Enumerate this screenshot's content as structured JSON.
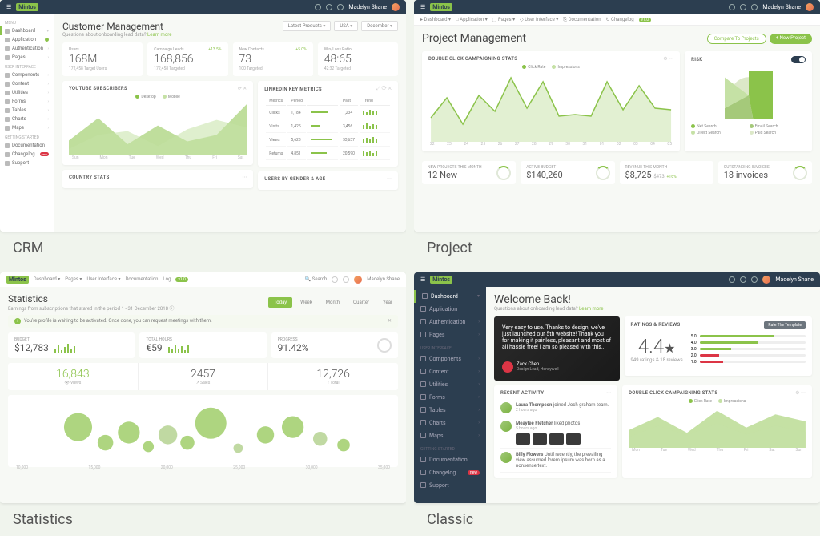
{
  "brand": "Mintos",
  "user": "Madelyn Shane",
  "labels": {
    "crm": "CRM",
    "project": "Project",
    "statistics": "Statistics",
    "classic": "Classic"
  },
  "sidebar_light": {
    "menu_hdr": "MENU",
    "items": [
      {
        "label": "Dashboard",
        "active": true
      },
      {
        "label": "Application",
        "dot": true
      },
      {
        "label": "Authentication",
        "chev": true
      },
      {
        "label": "Pages",
        "chev": true
      }
    ],
    "ui_hdr": "USER INTERFACE",
    "ui": [
      {
        "label": "Components",
        "chev": true
      },
      {
        "label": "Content",
        "chev": true
      },
      {
        "label": "Utilities",
        "chev": true
      },
      {
        "label": "Forms",
        "chev": true
      },
      {
        "label": "Tables",
        "chev": true
      },
      {
        "label": "Charts",
        "chev": true
      },
      {
        "label": "Maps",
        "chev": true
      }
    ],
    "gs_hdr": "GETTING STARTED",
    "gs": [
      {
        "label": "Documentation"
      },
      {
        "label": "Changelog",
        "pill": "new"
      },
      {
        "label": "Support"
      }
    ]
  },
  "crm": {
    "title": "Customer Management",
    "subq": "Questions about onboarding lead data?",
    "link": "Learn more",
    "selects": [
      "Latest Products",
      "USA",
      "December"
    ],
    "kpis": [
      {
        "label": "Users",
        "value": "168M",
        "sub": "172,458 Target Users"
      },
      {
        "label": "Campaign Leads",
        "value": "168,856",
        "sub": "172,458 Targeted",
        "pct": "+13.5%",
        "up": true
      },
      {
        "label": "New Contacts",
        "value": "73",
        "sub": "100 Targeted",
        "pct": "+5.0%",
        "up": true
      },
      {
        "label": "Win/Loss Ratio",
        "value": "48:65",
        "sub": "42:32 Targeted"
      }
    ],
    "yt": {
      "title": "YOUTUBE SUBSCRIBERS",
      "legend": [
        "Desktop",
        "Mobile"
      ],
      "x": [
        "Sun",
        "Mon",
        "Tue",
        "Wed",
        "Thu",
        "Fri",
        "Sat"
      ]
    },
    "li": {
      "title": "LINKEDIN KEY METRICS",
      "cols": [
        "Metrics",
        "Period",
        "",
        "Past",
        "Trend"
      ],
      "rows": [
        {
          "m": "Clicks",
          "p": "1,184",
          "past": "1,234"
        },
        {
          "m": "Visits",
          "p": "1,425",
          "past": "3,456"
        },
        {
          "m": "Views",
          "p": "5,623",
          "past": "53,637"
        },
        {
          "m": "Returns",
          "p": "4,851",
          "past": "20,590"
        }
      ]
    },
    "ug": {
      "title": "USERS BY GENDER & AGE"
    },
    "cs": {
      "title": "COUNTRY STATS"
    }
  },
  "chart_data": {
    "crm_youtube": {
      "type": "area",
      "x": [
        "Sun",
        "Mon",
        "Tue",
        "Wed",
        "Thu",
        "Fri",
        "Sat"
      ],
      "series": [
        {
          "name": "Desktop",
          "values": [
            45,
            90,
            35,
            75,
            40,
            60,
            155
          ]
        },
        {
          "name": "Mobile",
          "values": [
            20,
            55,
            65,
            30,
            70,
            100,
            85
          ]
        }
      ],
      "ylim": [
        0,
        175
      ]
    },
    "project_campaign": {
      "type": "line",
      "x": [
        "22",
        "23",
        "24",
        "25",
        "26",
        "27",
        "28",
        "29",
        "30",
        "31",
        "01",
        "02",
        "03",
        "04",
        "05"
      ],
      "series": [
        {
          "name": "Click Rate",
          "values": [
            200,
            380,
            150,
            400,
            280,
            600,
            320,
            580,
            250,
            260,
            240,
            580,
            300,
            520,
            320
          ]
        },
        {
          "name": "Impressions",
          "values": [
            120,
            300,
            180,
            350,
            200,
            450,
            260,
            400,
            220,
            200,
            210,
            420,
            240,
            380,
            260
          ]
        }
      ],
      "ylim": [
        50,
        700
      ],
      "legend_pos": "top"
    },
    "project_risk": {
      "type": "pie",
      "slices": [
        {
          "name": "Net Search",
          "value": 47.24
        },
        {
          "name": "Email Search",
          "value": 19.94
        },
        {
          "name": "Direct Search",
          "value": 18
        },
        {
          "name": "Paid Search",
          "value": 14.82
        }
      ]
    },
    "stats_bubbles": {
      "type": "scatter",
      "x": [
        12000,
        14000,
        16000,
        17000,
        18000,
        19000,
        20000,
        22000,
        25000,
        28000,
        31000,
        33000
      ],
      "y": [
        140,
        90,
        120,
        60,
        100,
        75,
        150,
        40,
        95,
        125,
        80,
        60
      ],
      "size": [
        40,
        25,
        35,
        18,
        30,
        22,
        45,
        14,
        28,
        34,
        24,
        20
      ],
      "xlim": [
        10000,
        35000
      ]
    },
    "classic_campaign": {
      "type": "area",
      "x": [
        "Mon",
        "Tue",
        "Wed",
        "Thu",
        "Fri",
        "Sat",
        "Sun"
      ],
      "series": [
        {
          "name": "Click Rate",
          "values": [
            800,
            1200,
            700,
            1400,
            900,
            1300,
            1100
          ]
        },
        {
          "name": "Impressions",
          "values": [
            500,
            900,
            600,
            1000,
            650,
            950,
            750
          ]
        }
      ],
      "ylim": [
        0,
        1500
      ]
    },
    "classic_ratings_bars": {
      "type": "bar",
      "categories": [
        "5.0",
        "4.0",
        "3.0",
        "2.0",
        "1.0"
      ],
      "series": [
        {
          "name": "pos",
          "values": [
            70,
            55,
            30,
            18,
            22
          ]
        },
        {
          "name": "neg",
          "values": [
            10,
            15,
            20,
            8,
            4
          ]
        }
      ]
    }
  },
  "project": {
    "breadcrumb": [
      "Dashboard",
      "Application",
      "Pages",
      "User Interface",
      "Documentation",
      "Changelog"
    ],
    "title": "Project Management",
    "btn1": "Compare To Projects",
    "btn2": "+ New Project",
    "camp": {
      "title": "DOUBLE CLICK CAMPAIGNING STATS",
      "legend": [
        "Click Rate",
        "Impressions"
      ]
    },
    "risk": {
      "title": "RISK",
      "legend": [
        "Net Search",
        "Email Search",
        "Direct Search",
        "Paid Search"
      ]
    },
    "stats": [
      {
        "label": "NEW PROJECTS THIS MONTH",
        "value": "12 New"
      },
      {
        "label": "ACTIVE BUDGET",
        "value": "$140,260"
      },
      {
        "label": "REVENUE THIS MONTH",
        "value": "$8,725",
        "sub": "$473",
        "pct": "+16%"
      },
      {
        "label": "OUTSTANDING INVOICES",
        "value": "18 invoices"
      }
    ]
  },
  "stats": {
    "breadcrumb": [
      "Dashboard",
      "Pages",
      "User Interface",
      "Documentation",
      "Log"
    ],
    "title": "Statistics",
    "sub": "Earnings from subscriptions that stared in the period 1 - 31 December 2018",
    "tabs": [
      "Today",
      "Week",
      "Month",
      "Quarter",
      "Year"
    ],
    "active_tab": 0,
    "alert": "You're profile is waiting to be activated. Once done, you can request meetings with them.",
    "kpis": [
      {
        "label": "BUDGET",
        "value": "$12,783"
      },
      {
        "label": "TOTAL HOURS",
        "value": "€59"
      },
      {
        "label": "PROGRESS",
        "value": "91.42%"
      }
    ],
    "mid": [
      {
        "value": "16,843",
        "label": "Views"
      },
      {
        "value": "2457",
        "label": "Sales"
      },
      {
        "value": "12,726",
        "label": "Total"
      }
    ]
  },
  "classic": {
    "title": "Welcome Back!",
    "subq": "Questions about onboarding lead data?",
    "link": "Learn more",
    "hero": {
      "text": "Very easy to use. Thanks to design, we've just launched our 5th website! Thank you for making it painless, pleasant and most of all hassle free! I am so pleased with this...",
      "author": "Zack Chen",
      "role": "Design Lead, Honeywell"
    },
    "ratings": {
      "title": "RATINGS & REVIEWS",
      "btn": "Rate The Template",
      "value": "4.4",
      "star": "★",
      "sub": "949 ratings & 18 reviews"
    },
    "recent": {
      "title": "RECENT ACTIVITY",
      "items": [
        {
          "name": "Laura Thompson",
          "action": "joined Josh graham team.",
          "time": "2 hours ago"
        },
        {
          "name": "Meaylee Fletcher",
          "action": "liked photos",
          "time": "5 hours ago",
          "photos": true
        },
        {
          "name": "Billy Flowers",
          "action": "Until recently, the prevailing view assumed lorem ipsum was born as a nonsense text.",
          "time": ""
        }
      ]
    },
    "camp": {
      "title": "DOUBLE CLICK CAMPAIGNING STATS",
      "legend": [
        "Click Rate",
        "Impressions"
      ]
    }
  }
}
